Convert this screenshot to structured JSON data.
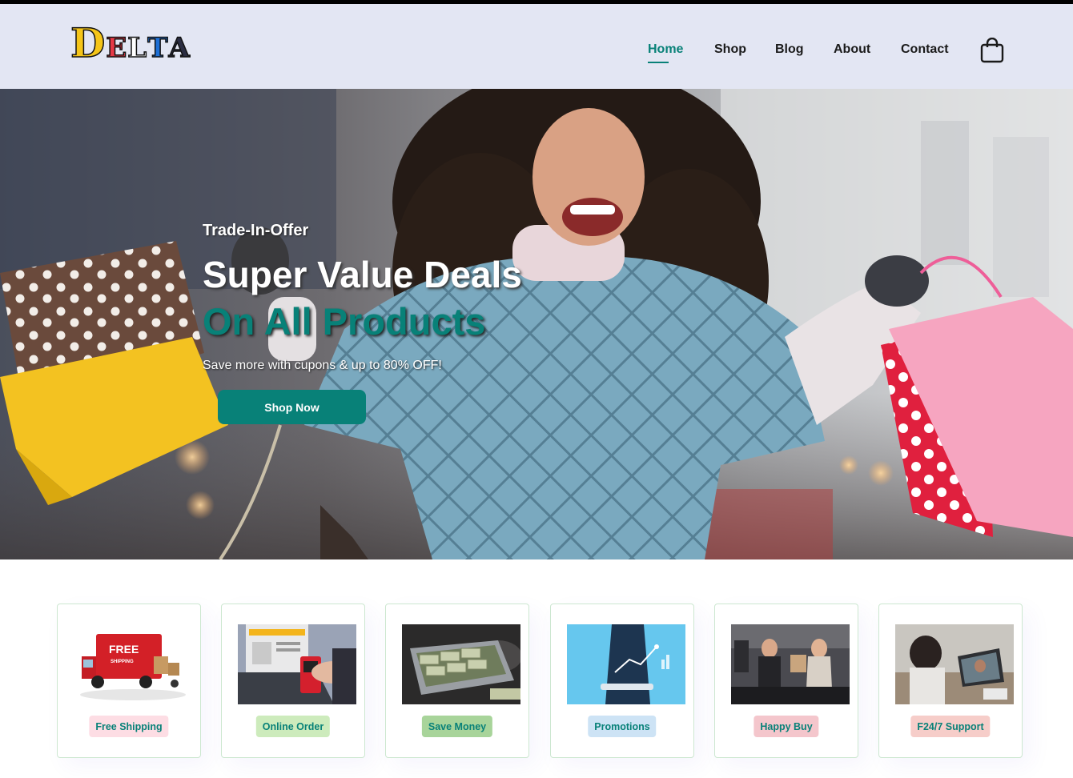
{
  "brand": {
    "logo_text": "Delta"
  },
  "nav": {
    "items": [
      {
        "label": "Home",
        "active": true
      },
      {
        "label": "Shop",
        "active": false
      },
      {
        "label": "Blog",
        "active": false
      },
      {
        "label": "About",
        "active": false
      },
      {
        "label": "Contact",
        "active": false
      }
    ],
    "cart_icon": "shopping-bag-icon"
  },
  "hero": {
    "eyebrow": "Trade-In-Offer",
    "headline": "Super Value Deals",
    "headline_accent": "On All Products",
    "subtext": "Save more with cupons & up to 80% OFF!",
    "cta_label": "Shop Now"
  },
  "features": [
    {
      "label": "Free Shipping",
      "tag_color": "#fddde4"
    },
    {
      "label": "Online Order",
      "tag_color": "#cdebbc"
    },
    {
      "label": "Save Money",
      "tag_color": "#a8d49a"
    },
    {
      "label": "Promotions",
      "tag_color": "#cde3f5"
    },
    {
      "label": "Happy Buy",
      "tag_color": "#f4c6cc"
    },
    {
      "label": "F24/7 Support",
      "tag_color": "#f6cdc9"
    }
  ],
  "colors": {
    "accent": "#088178",
    "header_bg": "#e3e6f3"
  }
}
